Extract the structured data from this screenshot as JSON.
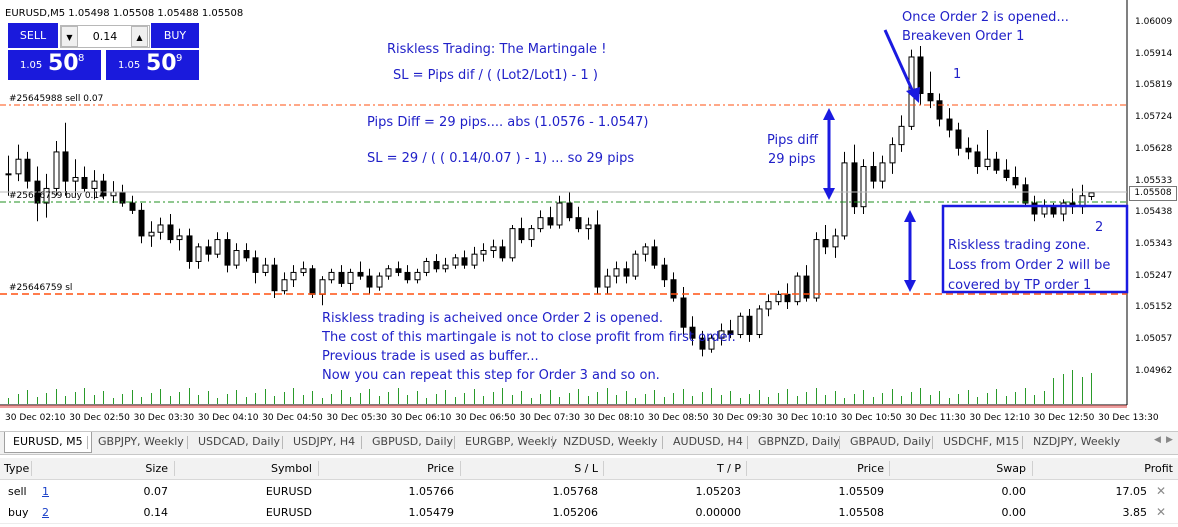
{
  "chart": {
    "symbol_title": "EURUSD,M5  1.05498 1.05508 1.05488 1.05508",
    "trade_panel": {
      "sell_label": "SELL",
      "buy_label": "BUY",
      "lot_value": "0.14",
      "down_arrow": "▼",
      "up_arrow": "▲",
      "sell_price": {
        "small": "1.05",
        "big": "50",
        "sup": "8"
      },
      "buy_price": {
        "small": "1.05",
        "big": "50",
        "sup": "9"
      }
    },
    "price_axis": [
      "1.06009",
      "1.05914",
      "1.05819",
      "1.05724",
      "1.05628",
      "1.05533",
      "1.05438",
      "1.05343",
      "1.05247",
      "1.05152",
      "1.05057",
      "1.04962"
    ],
    "current_price": "1.05508",
    "time_axis": [
      "30 Dec 02:10",
      "30 Dec 02:50",
      "30 Dec 03:30",
      "30 Dec 04:10",
      "30 Dec 04:50",
      "30 Dec 05:30",
      "30 Dec 06:10",
      "30 Dec 06:50",
      "30 Dec 07:30",
      "30 Dec 08:10",
      "30 Dec 08:50",
      "30 Dec 09:30",
      "30 Dec 10:10",
      "30 Dec 10:50",
      "30 Dec 11:30",
      "30 Dec 12:10",
      "30 Dec 12:50",
      "30 Dec 13:30"
    ],
    "order_lines": {
      "sell_label": "#25645988 sell 0.07",
      "buy_label": "#25646759 buy 0.14",
      "sl_label": "#25646759 sl",
      "sell_color": "#ff5010",
      "buy_color": "#209020",
      "sl_color": "#ff5010"
    },
    "annotations": {
      "title": "Riskless Trading: The Martingale !",
      "formula": "SL = Pips dif / ( (Lot2/Lot1) - 1 )",
      "pips_diff": "Pips Diff = 29 pips.... abs (1.0576 - 1.0547)",
      "sl_calc": "SL = 29 / ( ( 0.14/0.07 ) - 1) ... so 29 pips",
      "pips_label_1": "Pips diff",
      "pips_label_2": "29 pips",
      "order2_opened_1": "Once Order 2 is opened...",
      "order2_opened_2": "Breakeven Order 1",
      "order1_marker": "1",
      "order2_marker": "2",
      "zone_1": "Riskless trading zone.",
      "zone_2": "Loss from Order 2 will be",
      "zone_3": "covered by TP order 1",
      "note_1": "Riskless trading is acheived once Order 2 is opened.",
      "note_2": "The cost of this martingale is not to close profit from first order.",
      "note_3": "Previous trade is used as buffer...",
      "note_4": "Now you can repeat this step for Order 3 and so on.",
      "color": "#2020c8"
    },
    "chart_data": {
      "type": "candlestick",
      "symbol": "EURUSD",
      "timeframe": "M5",
      "ohlc_header": {
        "open": 1.05498,
        "high": 1.05508,
        "low": 1.05488,
        "close": 1.05508
      },
      "ylim": [
        1.049,
        1.061
      ],
      "candles": [
        [
          1.0556,
          1.0561,
          1.055,
          1.0556
        ],
        [
          1.0556,
          1.0564,
          1.0554,
          1.056
        ],
        [
          1.056,
          1.0562,
          1.0552,
          1.0554
        ],
        [
          1.0554,
          1.0558,
          1.0543,
          1.0548
        ],
        [
          1.0548,
          1.0556,
          1.0544,
          1.0552
        ],
        [
          1.0552,
          1.0565,
          1.055,
          1.0562
        ],
        [
          1.0562,
          1.057,
          1.055,
          1.0554
        ],
        [
          1.0554,
          1.056,
          1.055,
          1.0555
        ],
        [
          1.0555,
          1.0558,
          1.0551,
          1.0552
        ],
        [
          1.0552,
          1.0557,
          1.0549,
          1.0554
        ],
        [
          1.0554,
          1.0556,
          1.0549,
          1.055
        ],
        [
          1.055,
          1.0554,
          1.0548,
          1.0551
        ],
        [
          1.0551,
          1.0553,
          1.0547,
          1.0548
        ],
        [
          1.0548,
          1.055,
          1.0545,
          1.0546
        ],
        [
          1.0546,
          1.0548,
          1.0537,
          1.0539
        ],
        [
          1.0539,
          1.0543,
          1.0536,
          1.054
        ],
        [
          1.054,
          1.0544,
          1.0538,
          1.0542
        ],
        [
          1.0542,
          1.0545,
          1.0537,
          1.0538
        ],
        [
          1.0538,
          1.0541,
          1.0535,
          1.0539
        ],
        [
          1.0539,
          1.0541,
          1.053,
          1.0532
        ],
        [
          1.0532,
          1.0537,
          1.053,
          1.0536
        ],
        [
          1.0536,
          1.0538,
          1.0532,
          1.0534
        ],
        [
          1.0534,
          1.054,
          1.0533,
          1.0538
        ],
        [
          1.0538,
          1.054,
          1.0529,
          1.0531
        ],
        [
          1.0531,
          1.0537,
          1.053,
          1.0535
        ],
        [
          1.0535,
          1.0537,
          1.0532,
          1.0533
        ],
        [
          1.0533,
          1.0535,
          1.0526,
          1.0529
        ],
        [
          1.0529,
          1.0533,
          1.0528,
          1.0531
        ],
        [
          1.0531,
          1.0533,
          1.0522,
          1.0524
        ],
        [
          1.0524,
          1.0529,
          1.0523,
          1.0527
        ],
        [
          1.0527,
          1.0531,
          1.0525,
          1.0529
        ],
        [
          1.0529,
          1.0532,
          1.0528,
          1.053
        ],
        [
          1.053,
          1.0531,
          1.0522,
          1.0523
        ],
        [
          1.0523,
          1.0528,
          1.052,
          1.0527
        ],
        [
          1.0527,
          1.053,
          1.0526,
          1.0529
        ],
        [
          1.0529,
          1.0531,
          1.0525,
          1.0526
        ],
        [
          1.0526,
          1.053,
          1.0524,
          1.0529
        ],
        [
          1.0529,
          1.0532,
          1.0527,
          1.0528
        ],
        [
          1.0528,
          1.053,
          1.0523,
          1.0525
        ],
        [
          1.0525,
          1.0529,
          1.0524,
          1.0528
        ],
        [
          1.0528,
          1.0531,
          1.0527,
          1.053
        ],
        [
          1.053,
          1.0532,
          1.0528,
          1.0529
        ],
        [
          1.0529,
          1.0531,
          1.0526,
          1.0527
        ],
        [
          1.0527,
          1.053,
          1.0526,
          1.0529
        ],
        [
          1.0529,
          1.0533,
          1.0528,
          1.0532
        ],
        [
          1.0532,
          1.0534,
          1.0529,
          1.053
        ],
        [
          1.053,
          1.0533,
          1.0529,
          1.0531
        ],
        [
          1.0531,
          1.0534,
          1.053,
          1.0533
        ],
        [
          1.0533,
          1.0535,
          1.053,
          1.0531
        ],
        [
          1.0531,
          1.0536,
          1.053,
          1.0534
        ],
        [
          1.0534,
          1.0537,
          1.0532,
          1.0535
        ],
        [
          1.0535,
          1.0538,
          1.0533,
          1.0536
        ],
        [
          1.0536,
          1.0538,
          1.0532,
          1.0533
        ],
        [
          1.0533,
          1.0542,
          1.0532,
          1.0541
        ],
        [
          1.0541,
          1.0544,
          1.0537,
          1.0538
        ],
        [
          1.0538,
          1.0542,
          1.0536,
          1.0541
        ],
        [
          1.0541,
          1.0546,
          1.054,
          1.0544
        ],
        [
          1.0544,
          1.0547,
          1.0541,
          1.0542
        ],
        [
          1.0542,
          1.055,
          1.0541,
          1.0548
        ],
        [
          1.0548,
          1.0551,
          1.0543,
          1.0544
        ],
        [
          1.0544,
          1.0547,
          1.054,
          1.0541
        ],
        [
          1.0541,
          1.0544,
          1.0538,
          1.0542
        ],
        [
          1.0542,
          1.0546,
          1.0523,
          1.0525
        ],
        [
          1.0525,
          1.053,
          1.0523,
          1.0528
        ],
        [
          1.0528,
          1.0532,
          1.0526,
          1.053
        ],
        [
          1.053,
          1.0532,
          1.0526,
          1.0528
        ],
        [
          1.0528,
          1.0535,
          1.0527,
          1.0534
        ],
        [
          1.0534,
          1.0537,
          1.0532,
          1.0536
        ],
        [
          1.0536,
          1.0538,
          1.053,
          1.0531
        ],
        [
          1.0531,
          1.0533,
          1.0525,
          1.0527
        ],
        [
          1.0527,
          1.0529,
          1.0521,
          1.0522
        ],
        [
          1.0522,
          1.0525,
          1.0512,
          1.0514
        ],
        [
          1.0514,
          1.0517,
          1.0509,
          1.0511
        ],
        [
          1.0511,
          1.0513,
          1.0506,
          1.0508
        ],
        [
          1.0508,
          1.0512,
          1.0507,
          1.0511
        ],
        [
          1.0511,
          1.0515,
          1.0509,
          1.0513
        ],
        [
          1.0513,
          1.0516,
          1.0511,
          1.0512
        ],
        [
          1.0512,
          1.0518,
          1.0511,
          1.0517
        ],
        [
          1.0517,
          1.0519,
          1.051,
          1.0512
        ],
        [
          1.0512,
          1.052,
          1.0511,
          1.0519
        ],
        [
          1.0519,
          1.0523,
          1.0517,
          1.0521
        ],
        [
          1.0521,
          1.0524,
          1.052,
          1.0523
        ],
        [
          1.0523,
          1.0526,
          1.0519,
          1.0521
        ],
        [
          1.0521,
          1.0529,
          1.052,
          1.0528
        ],
        [
          1.0528,
          1.0531,
          1.0521,
          1.0522
        ],
        [
          1.0522,
          1.054,
          1.0521,
          1.0538
        ],
        [
          1.0538,
          1.0542,
          1.0534,
          1.0536
        ],
        [
          1.0536,
          1.0541,
          1.0533,
          1.0539
        ],
        [
          1.0539,
          1.0562,
          1.0538,
          1.0559
        ],
        [
          1.0559,
          1.0564,
          1.0545,
          1.0547
        ],
        [
          1.0547,
          1.056,
          1.0545,
          1.0558
        ],
        [
          1.0558,
          1.0562,
          1.0552,
          1.0554
        ],
        [
          1.0554,
          1.0561,
          1.0552,
          1.0559
        ],
        [
          1.0559,
          1.0566,
          1.0556,
          1.0564
        ],
        [
          1.0564,
          1.0572,
          1.0562,
          1.0569
        ],
        [
          1.0569,
          1.059,
          1.0568,
          1.0588
        ],
        [
          1.0588,
          1.0591,
          1.0575,
          1.0578
        ],
        [
          1.0578,
          1.0584,
          1.0574,
          1.0576
        ],
        [
          1.0576,
          1.0578,
          1.0569,
          1.0571
        ],
        [
          1.0571,
          1.0574,
          1.0566,
          1.0568
        ],
        [
          1.0568,
          1.057,
          1.0561,
          1.0563
        ],
        [
          1.0563,
          1.0566,
          1.056,
          1.0562
        ],
        [
          1.0562,
          1.0564,
          1.0556,
          1.0558
        ],
        [
          1.0558,
          1.0568,
          1.0557,
          1.056
        ],
        [
          1.056,
          1.0562,
          1.0556,
          1.0557
        ],
        [
          1.0557,
          1.056,
          1.0554,
          1.0555
        ],
        [
          1.0555,
          1.0558,
          1.0552,
          1.0553
        ],
        [
          1.0553,
          1.0555,
          1.0547,
          1.0548
        ],
        [
          1.0548,
          1.055,
          1.0543,
          1.0545
        ],
        [
          1.0545,
          1.0549,
          1.0544,
          1.0547
        ],
        [
          1.0547,
          1.0548,
          1.0544,
          1.0545
        ],
        [
          1.0545,
          1.0549,
          1.0543,
          1.0548
        ],
        [
          1.0548,
          1.0552,
          1.0545,
          1.0547
        ],
        [
          1.0547,
          1.0553,
          1.0545,
          1.055
        ],
        [
          1.05498,
          1.05508,
          1.05488,
          1.05508
        ]
      ]
    }
  },
  "tabs": [
    {
      "label": "EURUSD, M5",
      "active": true
    },
    {
      "label": "GBPJPY, Weekly"
    },
    {
      "label": "USDCAD, Daily"
    },
    {
      "label": "USDJPY, H4"
    },
    {
      "label": "GBPUSD, Daily"
    },
    {
      "label": "EURGBP, Weekly"
    },
    {
      "label": "NZDUSD, Weekly"
    },
    {
      "label": "AUDUSD, H4"
    },
    {
      "label": "GBPNZD, Daily"
    },
    {
      "label": "GBPAUD, Daily"
    },
    {
      "label": "USDCHF, M15"
    },
    {
      "label": "NZDJPY, Weekly"
    }
  ],
  "tab_nav": {
    "prev": "◀",
    "next": "▶"
  },
  "trades": {
    "headers": {
      "type": "Type",
      "size": "Size",
      "symbol": "Symbol",
      "price": "Price",
      "sl": "S / L",
      "tp": "T / P",
      "price2": "Price",
      "swap": "Swap",
      "profit": "Profit"
    },
    "rows": [
      {
        "type": "sell",
        "order": "1",
        "size": "0.07",
        "symbol": "EURUSD",
        "price": "1.05766",
        "sl": "1.05768",
        "tp": "1.05203",
        "price2": "1.05509",
        "swap": "0.00",
        "profit": "17.05",
        "close": "✕"
      },
      {
        "type": "buy",
        "order": "2",
        "size": "0.14",
        "symbol": "EURUSD",
        "price": "1.05479",
        "sl": "1.05206",
        "tp": "0.00000",
        "price2": "1.05508",
        "swap": "0.00",
        "profit": "3.85",
        "close": "✕"
      }
    ]
  }
}
